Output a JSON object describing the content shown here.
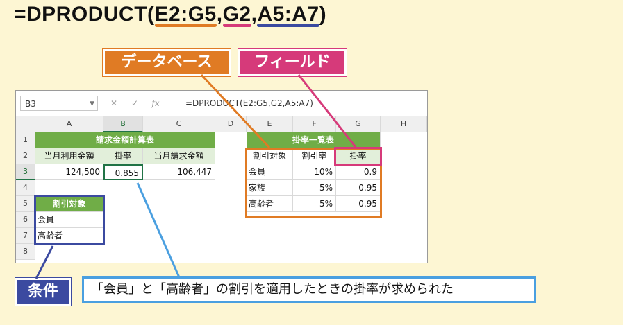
{
  "formula": {
    "prefix": "=DPRODUCT(",
    "arg_database": "E2:G5",
    "sep1": ",",
    "arg_field": "G2",
    "sep2": ",",
    "arg_criteria": "A5:A7",
    "suffix": ")"
  },
  "labels": {
    "database": "データベース",
    "field": "フィールド",
    "criteria": "条件",
    "result_note": "「会員」と「高齢者」の割引を適用したときの掛率が求められた"
  },
  "colors": {
    "database": "#e07b24",
    "field": "#d63a7a",
    "criteria": "#3b4aa0",
    "result": "#4a9fe0",
    "header_green": "#70ad47"
  },
  "excel": {
    "name_box": "B3",
    "formula_bar": "=DPRODUCT(E2:G5,G2,A5:A7)",
    "icons": [
      "cancel-icon",
      "confirm-icon",
      "function-icon"
    ],
    "columns": [
      "A",
      "B",
      "C",
      "D",
      "E",
      "F",
      "G",
      "H"
    ],
    "rows": [
      "1",
      "2",
      "3",
      "4",
      "5",
      "6",
      "7",
      "8"
    ],
    "calc_table": {
      "title": "請求金額計算表",
      "headers": [
        "当月利用金額",
        "掛率",
        "当月請求金額"
      ],
      "values": [
        "124,500",
        "0.855",
        "106,447"
      ]
    },
    "rate_table": {
      "title": "掛率一覧表",
      "headers": [
        "割引対象",
        "割引率",
        "掛率"
      ],
      "rows": [
        [
          "会員",
          "10%",
          "0.9"
        ],
        [
          "家族",
          "5%",
          "0.95"
        ],
        [
          "高齢者",
          "5%",
          "0.95"
        ]
      ]
    },
    "criteria_table": {
      "header": "割引対象",
      "values": [
        "会員",
        "高齢者"
      ]
    }
  }
}
